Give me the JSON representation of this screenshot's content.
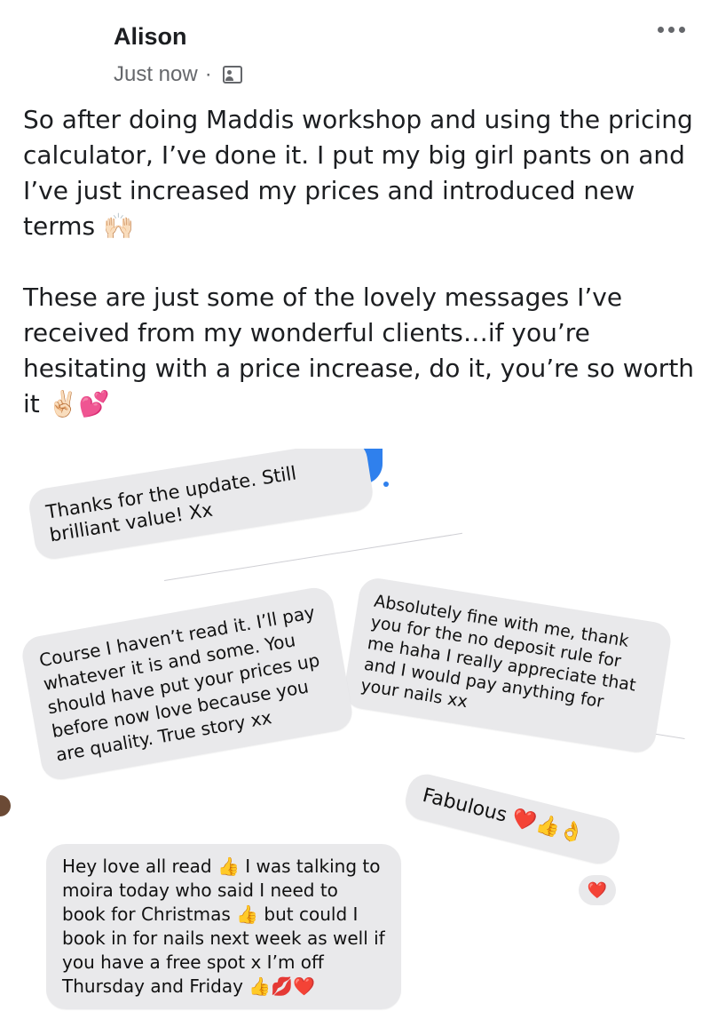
{
  "post": {
    "author": "Alison",
    "timestamp": "Just now",
    "separator": "·",
    "audience_icon": "friends-icon",
    "more_icon": "more-options-icon",
    "paragraph1": "So after doing Maddis workshop and using the pricing calculator, I’ve done it. I put my big girl pants on and I’ve just increased my prices and introduced new terms 🙌🏻",
    "paragraph2": "These are just some of the lovely messages I’ve received from my wonderful clients…if you’re hesitating with a price increase, do it, you’re so worth it ✌🏻💕"
  },
  "messages": [
    {
      "text": "Thanks for the update. Still brilliant value! Xx"
    },
    {
      "text": "Absolutely fine with me, thank you for the no deposit rule for me haha I really appreciate that and I would pay anything for your nails xx"
    },
    {
      "text": "Course I haven’t read it. I’ll pay whatever it is and some. You should have put your prices up before now love because you are quality. True story xx"
    },
    {
      "text": "Fabulous ❤️👍👌"
    },
    {
      "text": "Hey love all read 👍 I was talking to moira today who said I need to book for Christmas 👍 but could I book in for nails next week as well if you have a free spot x I’m off Thursday and Friday 👍💋❤️"
    }
  ],
  "reactions": {
    "heart_reaction": "♥",
    "small_heart": "❤️"
  },
  "colors": {
    "bubble": "#e9e9eb",
    "reaction_blue": "#2f80ed",
    "meta_gray": "#65676b",
    "text": "#1c1e21"
  }
}
